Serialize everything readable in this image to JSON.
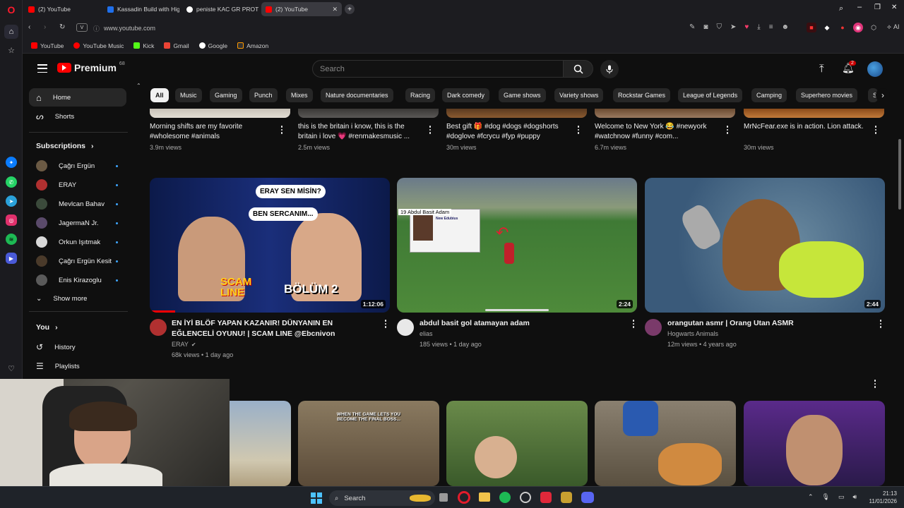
{
  "browser": {
    "tabs": [
      {
        "label": "(2) YouTube",
        "color": "#ff0000",
        "active": false
      },
      {
        "label": "Kassadin Build with High",
        "color": "#1f6feb",
        "active": false
      },
      {
        "label": "peniste KAC GR PROTEIN",
        "color": "#ffffff",
        "active": false
      },
      {
        "label": "(2) YouTube",
        "color": "#ff0000",
        "active": true
      }
    ],
    "url": "www.youtube.com",
    "bookmarks": [
      {
        "label": "YouTube",
        "icon": "youtube-icon",
        "color": "#ff0000"
      },
      {
        "label": "YouTube Music",
        "icon": "youtube-music-icon",
        "color": "#ff0000"
      },
      {
        "label": "Kick",
        "icon": "kick-icon",
        "color": "#53fc18"
      },
      {
        "label": "Gmail",
        "icon": "gmail-icon",
        "color": "#ea4335"
      },
      {
        "label": "Google",
        "icon": "google-icon",
        "color": "#4285f4"
      },
      {
        "label": "Amazon",
        "icon": "amazon-icon",
        "color": "#ff9900"
      }
    ],
    "aria_label": "AI"
  },
  "youtube": {
    "logo_text": "Premium",
    "logo_badge": "68",
    "search_placeholder": "Search",
    "notif_count": "2",
    "sidebar": {
      "home": "Home",
      "shorts": "Shorts",
      "subscriptions_heading": "Subscriptions",
      "subscriptions": [
        {
          "name": "Çağrı Ergün",
          "color": "#6b5a44"
        },
        {
          "name": "ERAY",
          "color": "#b03030"
        },
        {
          "name": "Mevlcan Bahav",
          "color": "#3b4a3b"
        },
        {
          "name": "JagermaN Jr.",
          "color": "#5a4a6a"
        },
        {
          "name": "Orkun Işıtmak",
          "color": "#d8d8d8"
        },
        {
          "name": "Çağrı Ergün Kesit",
          "color": "#4a3a2a"
        },
        {
          "name": "Enis Kirazoglu",
          "color": "#5a5a5a"
        }
      ],
      "show_more": "Show more",
      "you_heading": "You",
      "history": "History",
      "playlists": "Playlists"
    },
    "chips": [
      "All",
      "Music",
      "Gaming",
      "Punch",
      "Mixes",
      "Nature documentaries",
      "Racing",
      "Dark comedy",
      "Game shows",
      "Variety shows",
      "Rockstar Games",
      "League of Legends",
      "Camping",
      "Superhero movies",
      "S"
    ],
    "shorts_top": [
      {
        "title": "Morning shifts are my favorite #wholesome #animals",
        "views": "3.9m views",
        "color": "#d8d2c8"
      },
      {
        "title": "this is the britain i know, this is the britain i love 💗 #renmakesmusic ...",
        "views": "2.5m views",
        "color": "#4a4846"
      },
      {
        "title": "Best gift 🎁 #dog #dogs #dogshorts #doglove #fcrycu #fyp #puppy",
        "views": "30m views",
        "color": "#6a4a30"
      },
      {
        "title": "Welcome to New York 😂 #newyork #watchnow #funny #com...",
        "views": "6.7m views",
        "color": "#7a5a40"
      },
      {
        "title": "MrNcFear.exe is in action. Lion attack.",
        "views": "30m views",
        "color": "#9a5a2a"
      }
    ],
    "videos": [
      {
        "title": "EN İYİ BLÖF YAPAN KAZANIR! DÜNYANIN EN EĞLENCELİ OYUNU! | SCAM LINE @Ebcnivon",
        "channel": "ERAY",
        "verified": true,
        "meta": "68k views • 1 day ago",
        "duration": "1:12:06",
        "thumb_text_1": "ERAY SEN MİSİN?",
        "thumb_text_2": "BEN SERCANIM...",
        "thumb_text_3": "SCAM LINE",
        "thumb_text_4": "BÖLÜM 2",
        "ava_color": "#b03030"
      },
      {
        "title": "abdul basit gol atamayan adam",
        "channel": "elias",
        "verified": false,
        "meta": "185 views • 1 day ago",
        "duration": "2:24",
        "thumb_text_1": "19 Abdul Basit Adam",
        "thumb_text_2": "New Edubius",
        "ava_color": "#e8e8e8"
      },
      {
        "title": "orangutan asmr | Orang Utan ASMR",
        "channel": "Hogwarts Animals",
        "verified": false,
        "meta": "12m views • 4 years ago",
        "duration": "2:44",
        "ava_color": "#7a3a6a"
      }
    ],
    "shorts_bottom": [
      {
        "color": "#8aa0b8"
      },
      {
        "color": "#6a5a48",
        "caption": "WHEN THE GAME LETS YOU BECOME THE FINAL BOSS..."
      },
      {
        "color": "#4a6a3a"
      },
      {
        "color": "#7a7060"
      },
      {
        "color": "#3a2a5a"
      }
    ]
  },
  "taskbar": {
    "search_label": "Search",
    "time": "21:13",
    "date": "11/01/2026"
  }
}
